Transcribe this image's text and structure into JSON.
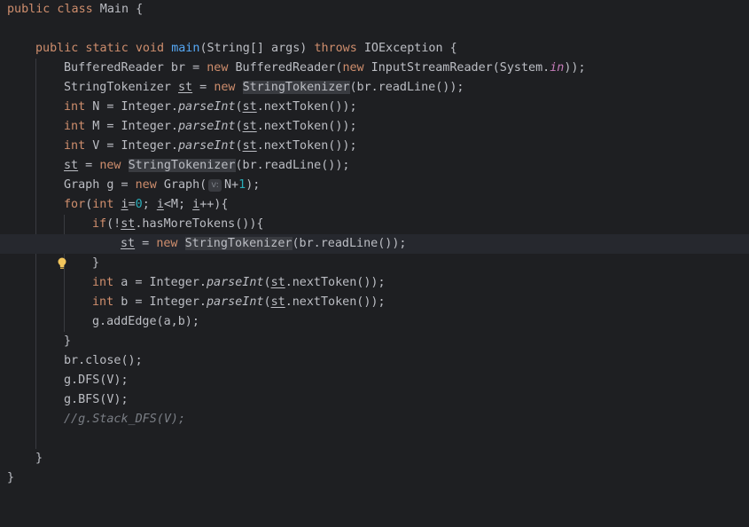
{
  "colors": {
    "background": "#1e1f22",
    "current_line": "#26282e",
    "keyword": "#cf8e6d",
    "method_decl": "#56a8f5",
    "static_field": "#c77dbb",
    "number": "#2aacb8",
    "comment": "#7a7e85",
    "default_text": "#bcbec4",
    "bulb": "#f2c55c"
  },
  "code": {
    "l1": {
      "t1": "public class",
      "t2": " Main {"
    },
    "l3": {
      "t1": "public static void",
      "t2": " ",
      "t3": "main",
      "t4": "(String[] args) ",
      "t5": "throws",
      "t6": " IOException {"
    },
    "l4": {
      "t1": "BufferedReader br = ",
      "t2": "new",
      "t3": " BufferedReader(",
      "t4": "new",
      "t5": " InputStreamReader(System.",
      "t6": "in",
      "t7": "));"
    },
    "l5": {
      "t1": "StringTokenizer ",
      "t2": "st",
      "t3": " = ",
      "t4": "new",
      "t5": " ",
      "t6": "StringTokenizer",
      "t7": "(br.readLine());"
    },
    "l6": {
      "t1": "int",
      "t2": " N = Integer.",
      "t3": "parseInt",
      "t4": "(",
      "t5": "st",
      "t6": ".nextToken());"
    },
    "l7": {
      "t1": "int",
      "t2": " M = Integer.",
      "t3": "parseInt",
      "t4": "(",
      "t5": "st",
      "t6": ".nextToken());"
    },
    "l8": {
      "t1": "int",
      "t2": " V = Integer.",
      "t3": "parseInt",
      "t4": "(",
      "t5": "st",
      "t6": ".nextToken());"
    },
    "l9": {
      "t1": "st",
      "t2": " = ",
      "t3": "new",
      "t4": " ",
      "t5": "StringTokenizer",
      "t6": "(br.readLine());"
    },
    "l10": {
      "t1": "Graph g = ",
      "t2": "new",
      "t3": " Graph(",
      "hint": "v:",
      "t4": "N+",
      "t5": "1",
      "t6": ");"
    },
    "l11": {
      "t1": "for",
      "t2": "(",
      "t3": "int",
      "t4": " ",
      "t5": "i",
      "t6": "=",
      "t7": "0",
      "t8": "; ",
      "t9": "i",
      "t10": "<M; ",
      "t11": "i",
      "t12": "++){"
    },
    "l12": {
      "t1": "if",
      "t2": "(!",
      "t3": "st",
      "t4": ".hasMoreTokens()){"
    },
    "l13": {
      "t1": "st",
      "t2": " = ",
      "t3": "new",
      "t4": " ",
      "t5": "StringTokenizer",
      "t6": "(br.readLine());"
    },
    "l14": {
      "t1": "}"
    },
    "l15": {
      "t1": "int",
      "t2": " a = Integer.",
      "t3": "parseInt",
      "t4": "(",
      "t5": "st",
      "t6": ".nextToken());"
    },
    "l16": {
      "t1": "int",
      "t2": " b = Integer.",
      "t3": "parseInt",
      "t4": "(",
      "t5": "st",
      "t6": ".nextToken());"
    },
    "l17": {
      "t1": "g.addEdge(a,b);"
    },
    "l18": {
      "t1": "}"
    },
    "l19": {
      "t1": "br.close();"
    },
    "l20": {
      "t1": "g.DFS(V);"
    },
    "l21": {
      "t1": "g.BFS(V);"
    },
    "l22": {
      "t1": "//g.Stack_DFS(V);"
    },
    "l24": {
      "t1": "}"
    },
    "l25": {
      "t1": "}"
    }
  }
}
